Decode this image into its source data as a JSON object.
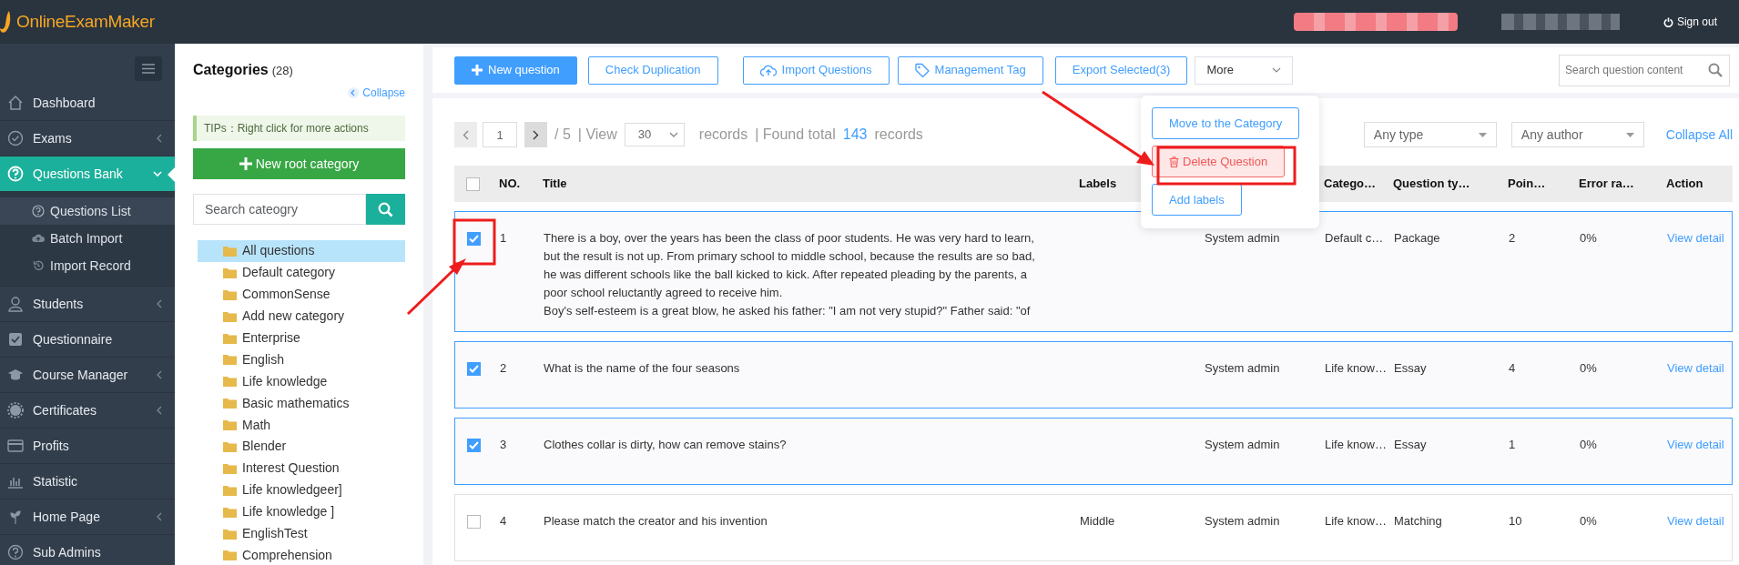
{
  "app": {
    "logo": "OnlineExamMaker",
    "sign_out": "Sign out"
  },
  "sidebar": {
    "items": [
      {
        "label": "Dashboard",
        "expandable": false,
        "selected": false
      },
      {
        "label": "Exams",
        "expandable": true,
        "expanded": false,
        "selected": false
      },
      {
        "label": "Questions Bank",
        "expandable": true,
        "expanded": true,
        "selected": true,
        "children": [
          {
            "label": "Questions List",
            "selected": true
          },
          {
            "label": "Batch Import",
            "selected": false
          },
          {
            "label": "Import Record",
            "selected": false
          }
        ]
      },
      {
        "label": "Students",
        "expandable": true,
        "expanded": false,
        "selected": false
      },
      {
        "label": "Questionnaire",
        "expandable": false,
        "selected": false
      },
      {
        "label": "Course Manager",
        "expandable": true,
        "expanded": false,
        "selected": false
      },
      {
        "label": "Certificates",
        "expandable": true,
        "expanded": false,
        "selected": false
      },
      {
        "label": "Profits",
        "expandable": false,
        "selected": false
      },
      {
        "label": "Statistic",
        "expandable": false,
        "selected": false
      },
      {
        "label": "Home Page",
        "expandable": true,
        "expanded": false,
        "selected": false
      },
      {
        "label": "Sub Admins",
        "expandable": false,
        "selected": false
      }
    ]
  },
  "categories": {
    "title": "Categories",
    "count": "(28)",
    "collapse": "Collapse",
    "tip": "TIPs：Right click for more actions",
    "new_button": "New root category",
    "search_placeholder": "Search cateogry",
    "items": [
      {
        "label": "All questions",
        "selected": true
      },
      {
        "label": "Default category",
        "selected": false
      },
      {
        "label": "CommonSense",
        "selected": false
      },
      {
        "label": "Add new category",
        "selected": false
      },
      {
        "label": "Enterprise",
        "selected": false
      },
      {
        "label": "English",
        "selected": false
      },
      {
        "label": "Life knowledge",
        "selected": false
      },
      {
        "label": "Basic mathematics",
        "selected": false
      },
      {
        "label": "Math",
        "selected": false
      },
      {
        "label": "Blender",
        "selected": false
      },
      {
        "label": "Interest Question",
        "selected": false
      },
      {
        "label": "Life knowledgeer]",
        "selected": false
      },
      {
        "label": "Life knowledge ]",
        "selected": false
      },
      {
        "label": "EnglishTest",
        "selected": false
      },
      {
        "label": "Comprehension",
        "selected": false
      }
    ]
  },
  "toolbar": {
    "buttons": [
      {
        "label": "New question",
        "kind": "primary"
      },
      {
        "label": "Check Duplication",
        "kind": "outline"
      },
      {
        "label": "Import Questions",
        "kind": "outline"
      },
      {
        "label": "Management Tag",
        "kind": "outline"
      },
      {
        "label": "Export Selected(3)",
        "kind": "outline"
      }
    ],
    "more": "More",
    "search_placeholder": "Search question content"
  },
  "more_menu": {
    "open": true,
    "items": [
      {
        "label": "Move to the Category",
        "kind": "normal"
      },
      {
        "label": "Delete Question",
        "kind": "danger"
      },
      {
        "label": "Add labels",
        "kind": "normal"
      }
    ]
  },
  "pagination": {
    "page": "1",
    "total_pages": "/ 5",
    "view_label": "|  View",
    "per_page": "30",
    "records_label": "records",
    "found_label": "|  Found total",
    "found_count": "143",
    "found_suffix": "records"
  },
  "filters": {
    "type": "Any type",
    "author": "Any author",
    "collapse_all": "Collapse All"
  },
  "table": {
    "header_checked": false,
    "columns": [
      "NO.",
      "Title",
      "Labels",
      "Catego…",
      "Question ty…",
      "Poin…",
      "Error ra…",
      "Action"
    ],
    "rows": [
      {
        "checked": true,
        "no": "1",
        "title": [
          "There is a boy, over the years has been the class of poor students. He was very hard to learn, but the result is not up. From primary school to middle school, because the results are so bad, he was different schools like the ball kicked to kick. After repeated pleading by the parents, a poor school reluctantly agreed to receive him.",
          "Boy's self-esteem is a great blow, he asked his father: \"I am not very stupid?\" Father said: \"of"
        ],
        "author": "System admin",
        "category": "Default c…",
        "type": "Package",
        "points": "2",
        "error": "0%",
        "action": "View detail"
      },
      {
        "checked": true,
        "no": "2",
        "title": [
          "What is the name of the four seasons"
        ],
        "author": "System admin",
        "category": "Life know…",
        "type": "Essay",
        "points": "4",
        "error": "0%",
        "action": "View detail"
      },
      {
        "checked": true,
        "no": "3",
        "title": [
          "Clothes collar is dirty, how can remove stains?"
        ],
        "author": "System admin",
        "category": "Life know…",
        "type": "Essay",
        "points": "1",
        "error": "0%",
        "action": "View detail"
      },
      {
        "checked": false,
        "no": "4",
        "title": [
          "Please match the creator and his invention"
        ],
        "labels": "Middle",
        "author": "System admin",
        "category": "Life know…",
        "type": "Matching",
        "points": "10",
        "error": "0%",
        "action": "View detail"
      }
    ]
  }
}
